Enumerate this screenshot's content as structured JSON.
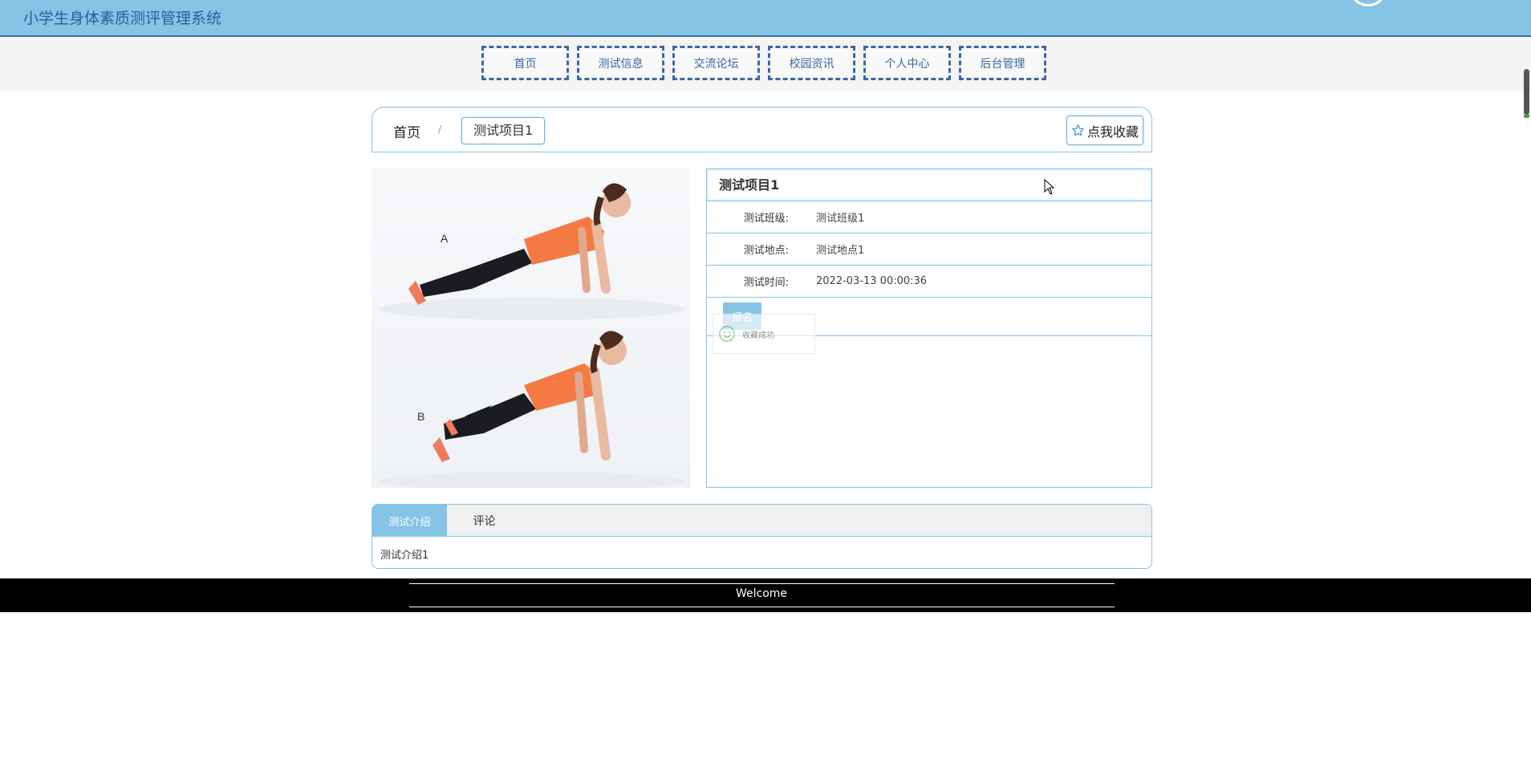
{
  "header": {
    "site_title": "小学生身体素质测评管理系统"
  },
  "nav": {
    "items": [
      "首页",
      "测试信息",
      "交流论坛",
      "校园资讯",
      "个人中心",
      "后台管理"
    ]
  },
  "breadcrumb": {
    "home": "首页",
    "separator": "/",
    "current": "测试项目1"
  },
  "favorite_button": {
    "label": "点我收藏",
    "icon": "star-icon"
  },
  "detail": {
    "title": "测试项目1",
    "rows": [
      {
        "label": "测试班级:",
        "value": "测试班级1"
      },
      {
        "label": "测试地点:",
        "value": "测试地点1"
      },
      {
        "label": "测试时间:",
        "value": "2022-03-13 00:00:36"
      }
    ],
    "signup_label": "报名"
  },
  "toast": {
    "text": "收藏成功",
    "icon": "smile-icon"
  },
  "tabs": {
    "items": [
      "测试介绍",
      "评论"
    ],
    "active_index": 0,
    "content": "测试介绍1"
  },
  "footer": {
    "text": "Welcome"
  },
  "image": {
    "markers": [
      "A",
      "B"
    ]
  },
  "colors": {
    "header_bg": "#86c4e6",
    "nav_border": "#3a68a5",
    "accent": "#86c4e6",
    "footer_bg": "#000000"
  }
}
